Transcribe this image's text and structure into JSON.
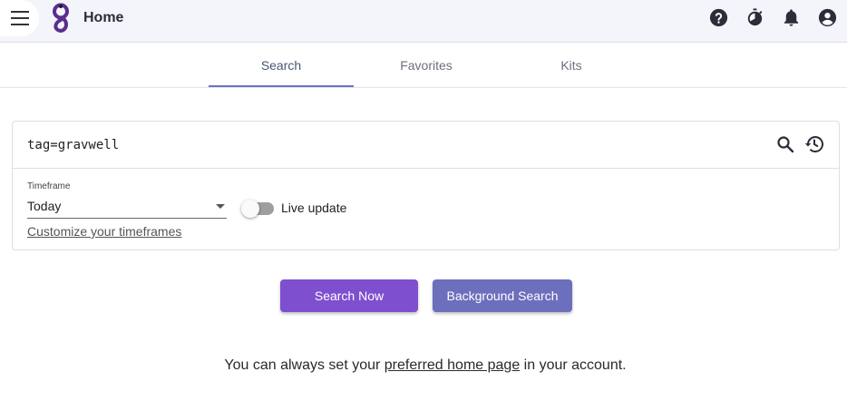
{
  "header": {
    "title": "Home",
    "menu_icon": "hamburger-menu-icon",
    "logo": "gravwell-logo",
    "icons": [
      "help-icon",
      "timer-icon",
      "notifications-icon",
      "account-icon"
    ]
  },
  "tabs": [
    {
      "label": "Search",
      "active": true
    },
    {
      "label": "Favorites",
      "active": false
    },
    {
      "label": "Kits",
      "active": false
    }
  ],
  "search": {
    "query": "tag=gravwell",
    "search_icon": "search-icon",
    "history_icon": "history-icon"
  },
  "timeframe": {
    "label": "Timeframe",
    "value": "Today",
    "customize_link": "Customize your timeframes"
  },
  "live_update": {
    "label": "Live update",
    "enabled": false
  },
  "buttons": {
    "search_now": "Search Now",
    "background_search": "Background Search"
  },
  "footer": {
    "prefix": "You can always set your ",
    "link": "preferred home page",
    "suffix": " in your account."
  },
  "colors": {
    "primary_button": "#7e4fcf",
    "secondary_button": "#6c6fbc",
    "active_tab_indicator": "#6c72c0",
    "logo": "#5b2d8e"
  }
}
